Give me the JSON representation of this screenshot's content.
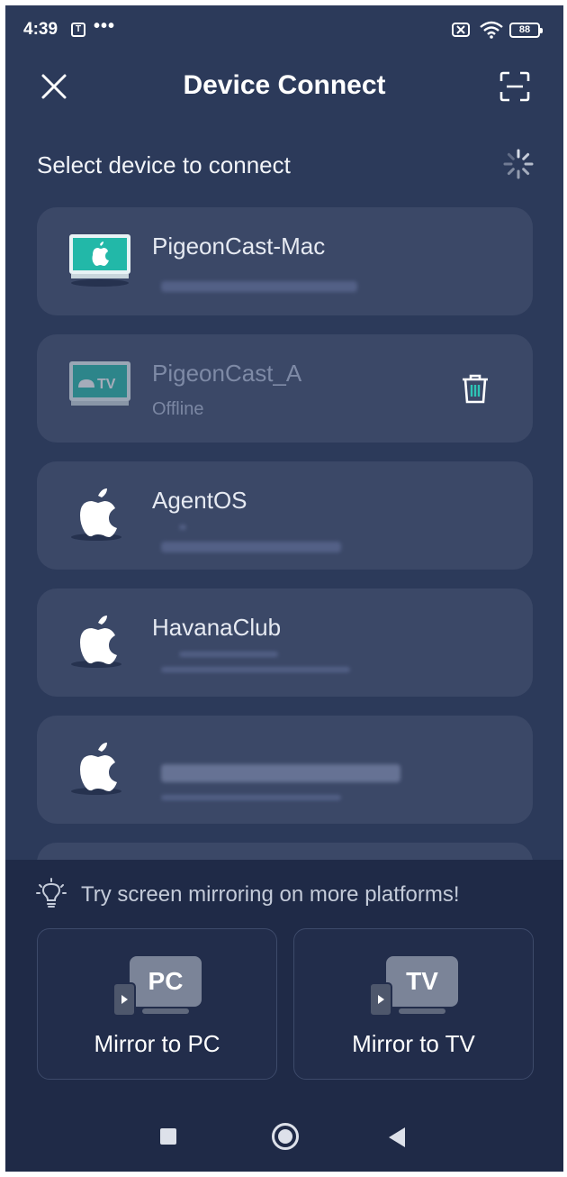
{
  "status_bar": {
    "time": "4:39",
    "app_icon_letter": "T",
    "more": "•••",
    "battery": "88"
  },
  "header": {
    "title": "Device Connect"
  },
  "section": {
    "label": "Select device to connect"
  },
  "devices": [
    {
      "name": "PigeonCast-Mac",
      "sub": "",
      "icon": "mac-monitor-icon",
      "status": "online"
    },
    {
      "name": "PigeonCast_A",
      "sub": "Offline",
      "icon": "android-tv-icon",
      "status": "offline"
    },
    {
      "name": "AgentOS",
      "sub": "",
      "icon": "apple-icon",
      "status": "online"
    },
    {
      "name": "HavanaClub",
      "sub": "",
      "icon": "apple-icon",
      "status": "online"
    },
    {
      "name": "",
      "sub": "",
      "icon": "apple-icon",
      "status": "online"
    }
  ],
  "tip": {
    "text": "Try screen mirroring on more platforms!"
  },
  "mirror_options": [
    {
      "badge": "PC",
      "label": "Mirror to PC"
    },
    {
      "badge": "TV",
      "label": "Mirror to TV"
    }
  ],
  "colors": {
    "background": "#2c3a5a",
    "card": "#3b4867",
    "panel": "#1f2a47",
    "accent": "#2ec4b6"
  }
}
